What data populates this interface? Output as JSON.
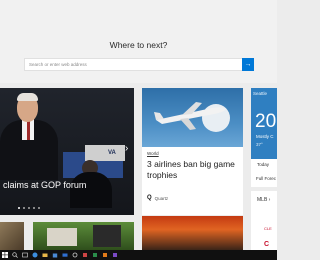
{
  "new_tab": {
    "heading": "Where to next?",
    "search_placeholder": "Search or enter web address",
    "go_label": "→"
  },
  "hero": {
    "headline": "claims at GOP forum",
    "sign_text": "VA",
    "next_arrow": "›",
    "slide_count": 5,
    "active_slide": 1
  },
  "news_card": {
    "category": "World",
    "title": "3 airlines ban big game trophies",
    "source_icon": "Q",
    "source": "Quartz"
  },
  "weather": {
    "city": "Seattle",
    "temp": "20",
    "condition": "Mostly C",
    "detail": "37°",
    "today_label": "Today",
    "forecast_link": "Full Forec"
  },
  "sports": {
    "title": "MLB",
    "chevron": "›",
    "team1": "CLE",
    "team2": "C"
  },
  "taskbar": {
    "icons": [
      "windows-icon",
      "search-icon",
      "task-view-icon",
      "edge-icon",
      "explorer-icon",
      "store-icon",
      "mail-icon",
      "settings-icon",
      "app-icon",
      "app-icon",
      "app-icon",
      "app-icon"
    ]
  }
}
